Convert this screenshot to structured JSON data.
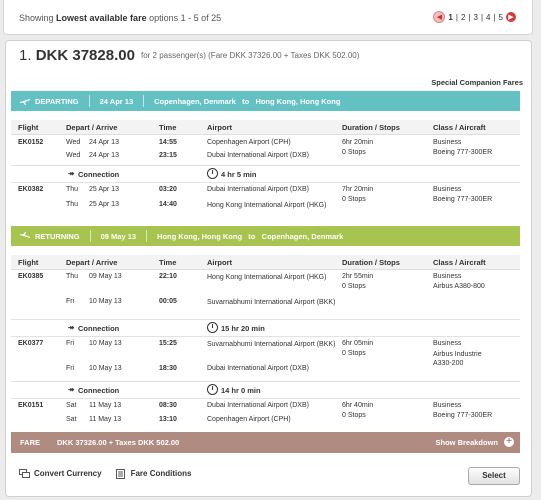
{
  "pagination": {
    "prefix": "Showing ",
    "emphasis": "Lowest available fare",
    "suffix": " options 1 - 5 of 25",
    "pages": [
      "1",
      "2",
      "3",
      "4",
      "5"
    ],
    "separators": "|",
    "current_page": "1"
  },
  "offer": {
    "index": "1.",
    "price": "DKK 37828.00",
    "detail": "for 2 passenger(s) (Fare DKK 37326.00 + Taxes DKK 502.00)",
    "companion_label": "Special Companion Fares",
    "colors": {
      "departing": "#63c1c4",
      "returning": "#a7c451",
      "fare": "#b08b82"
    }
  },
  "columns": [
    "Flight",
    "Depart / Arrive",
    "Time",
    "Airport",
    "Duration / Stops",
    "Class / Aircraft"
  ],
  "departing": {
    "label": "DEPARTING",
    "date": "24 Apr 13",
    "from": "Copenhagen, Denmark",
    "to_word": "to",
    "to": "Hong Kong, Hong Kong",
    "flights": [
      {
        "flight": "EK0152",
        "dep_day": "Wed",
        "dep_date": "24 Apr 13",
        "dep_time": "14:55",
        "dep_airport": "Copenhagen Airport (CPH)",
        "arr_day": "Wed",
        "arr_date": "24 Apr 13",
        "arr_time": "23:15",
        "arr_airport": "Dubai International Airport (DXB)",
        "duration": "6hr 20min",
        "stops": "0 Stops",
        "cabin": "Business",
        "aircraft": "Boeing 777-300ER"
      },
      {
        "flight": "EK0382",
        "dep_day": "Thu",
        "dep_date": "25 Apr 13",
        "dep_time": "03:20",
        "dep_airport": "Dubai International Airport (DXB)",
        "arr_day": "Thu",
        "arr_date": "25 Apr 13",
        "arr_time": "14:40",
        "arr_airport": "Hong Kong International Airport (HKG)",
        "duration": "7hr 20min",
        "stops": "0 Stops",
        "cabin": "Business",
        "aircraft": "Boeing 777-300ER"
      }
    ],
    "connections": [
      {
        "label": "Connection",
        "duration": "4 hr 5 min"
      }
    ]
  },
  "returning": {
    "label": "RETURNING",
    "date": "09 May 13",
    "from": "Hong Kong, Hong Kong",
    "to_word": "to",
    "to": "Copenhagen, Denmark",
    "flights": [
      {
        "flight": "EK0385",
        "dep_day": "Thu",
        "dep_date": "09 May 13",
        "dep_time": "22:10",
        "dep_airport": "Hong Kong International Airport (HKG)",
        "arr_day": "Fri",
        "arr_date": "10 May 13",
        "arr_time": "00:05",
        "arr_airport": "Suvarnabhumi International Airport (BKK)",
        "duration": "2hr 55min",
        "stops": "0 Stops",
        "cabin": "Business",
        "aircraft": "Airbus A380-800"
      },
      {
        "flight": "EK0377",
        "dep_day": "Fri",
        "dep_date": "10 May 13",
        "dep_time": "15:25",
        "dep_airport": "Suvarnabhumi International Airport (BKK)",
        "arr_day": "Fri",
        "arr_date": "10 May 13",
        "arr_time": "18:30",
        "arr_airport": "Dubai International Airport (DXB)",
        "duration": "6hr 05min",
        "stops": "0 Stops",
        "cabin": "Business",
        "aircraft": "Airbus Industrie A330-200"
      },
      {
        "flight": "EK0151",
        "dep_day": "Sat",
        "dep_date": "11 May 13",
        "dep_time": "08:30",
        "dep_airport": "Dubai International Airport (DXB)",
        "arr_day": "Sat",
        "arr_date": "11 May 13",
        "arr_time": "13:10",
        "arr_airport": "Copenhagen Airport (CPH)",
        "duration": "6hr 40min",
        "stops": "0 Stops",
        "cabin": "Business",
        "aircraft": "Boeing 777-300ER"
      }
    ],
    "connections": [
      {
        "label": "Connection",
        "duration": "15 hr 20 min"
      },
      {
        "label": "Connection",
        "duration": "14 hr 0 min"
      }
    ]
  },
  "fare_bar": {
    "label": "FARE",
    "breakdown": "DKK 37326.00 + Taxes DKK 502.00",
    "action": "Show Breakdown"
  },
  "footer": {
    "convert": "Convert Currency",
    "conditions": "Fare Conditions",
    "select": "Select"
  }
}
